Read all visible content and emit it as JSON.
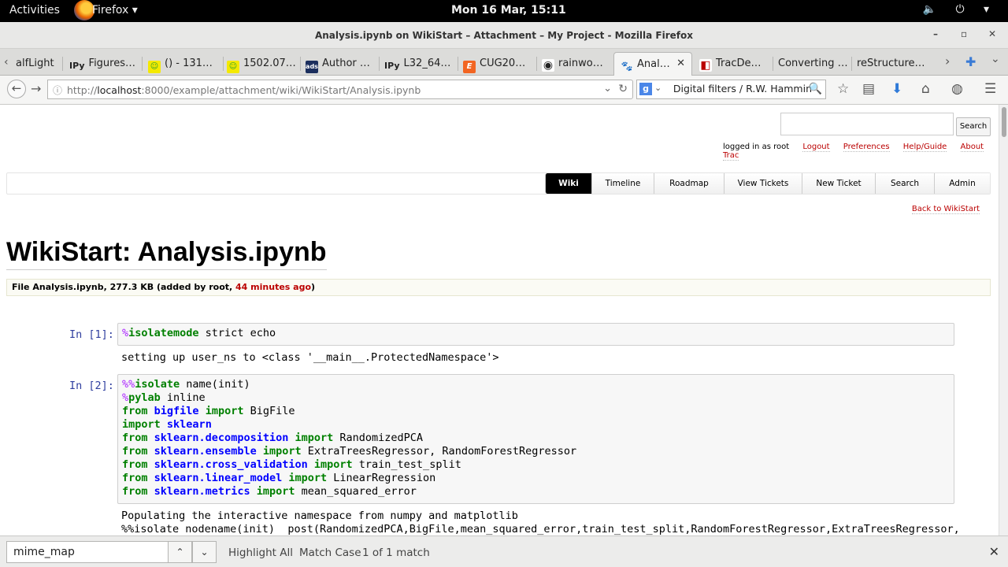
{
  "system": {
    "activities": "Activities",
    "app_name": "Firefox ▾",
    "clock": "Mon 16 Mar, 15:11",
    "tray": "🔈 ⏻ ▾"
  },
  "window": {
    "title": "Analysis.ipynb on WikiStart – Attachment – My Project - Mozilla Firefox",
    "minimize": "–",
    "maximize": "▫",
    "close": "✕"
  },
  "tabs": [
    {
      "label": "alfLight",
      "favicon_text": "",
      "favicon_color": ""
    },
    {
      "label": "Figures…",
      "favicon_text": "IPy",
      "favicon_color": ""
    },
    {
      "label": "() - 131…",
      "favicon_text": "☺",
      "favicon_color": "#2fa12f"
    },
    {
      "label": "1502.07…",
      "favicon_text": "☺",
      "favicon_color": "#2fa12f"
    },
    {
      "label": "Author …",
      "favicon_text": "ads",
      "favicon_color": "#1c2f5e"
    },
    {
      "label": "L32_64…",
      "favicon_text": "IPy",
      "favicon_color": ""
    },
    {
      "label": "CUG20…",
      "favicon_text": "E",
      "favicon_color": "#f26522"
    },
    {
      "label": "rainwo…",
      "favicon_text": "◉",
      "favicon_color": "#222"
    },
    {
      "label": "Anal…",
      "favicon_text": "🐾",
      "favicon_color": ""
    },
    {
      "label": "TracDe…",
      "favicon_text": "◧",
      "favicon_color": "#b00"
    },
    {
      "label": "Converting …",
      "favicon_text": "",
      "favicon_color": ""
    },
    {
      "label": "reStructure…",
      "favicon_text": "",
      "favicon_color": ""
    }
  ],
  "tab_controls": {
    "scroll_left": "‹",
    "scroll_right": "›",
    "new_tab": "✚",
    "list_all": "⌄",
    "close_active": "✕"
  },
  "navbar": {
    "url_prefix": "http://",
    "url_host": "localhost",
    "url_rest": ":8000/example/attachment/wiki/WikiStart/Analysis.ipynb",
    "search_value": "Digital filters / R.W. Hammin",
    "search_engine": "g"
  },
  "trac": {
    "search_button": "Search",
    "logged_in": "logged in as root",
    "metanav": [
      "Logout",
      "Preferences",
      "Help/Guide",
      "About Trac"
    ],
    "mainnav": [
      "Wiki",
      "Timeline",
      "Roadmap",
      "View Tickets",
      "New Ticket",
      "Search",
      "Admin"
    ],
    "back_link": "Back to WikiStart",
    "heading": "WikiStart: Analysis.ipynb",
    "file_info_pre": "File Analysis.ipynb, 277.3 KB (added by root, ",
    "file_info_ago": "44 minutes ago",
    "file_info_post": ")"
  },
  "notebook": {
    "prompt1": "In [1]:",
    "prompt2": "In [2]:",
    "cell1": {
      "magic": "%",
      "cmd": "isolatemode",
      "rest": " strict echo"
    },
    "out1": "setting up user_ns to <class '__main__.ProtectedNamespace'>",
    "cell2": {
      "l1_magic": "%%",
      "l1_cmd": "isolate",
      "l1_rest": " name(init)",
      "l2_magic": "%",
      "l2_cmd": "pylab",
      "l2_rest": " inline",
      "from": "from",
      "import": "import",
      "m_bigfile": "bigfile",
      "r_bigfile": " BigFile",
      "m_sklearn": "sklearn",
      "m_decomp": "sklearn.decomposition",
      "r_decomp": " RandomizedPCA",
      "m_ensemble": "sklearn.ensemble",
      "r_ensemble": " ExtraTreesRegressor, RandomForestRegressor",
      "m_cv": "sklearn.cross_validation",
      "r_cv": " train_test_split",
      "m_linear": "sklearn.linear_model",
      "r_linear": " LinearRegression",
      "m_metrics": "sklearn.metrics",
      "r_metrics": " mean_squared_error"
    },
    "out2_line1": "Populating the interactive namespace from numpy and matplotlib",
    "out2_line2": "%%isolate nodename(init)  post(RandomizedPCA,BigFile,mean_squared_error,train_test_split,RandomForestRegressor,ExtraTreesRegressor,"
  },
  "findbar": {
    "value": "mime_map",
    "prev": "⌃",
    "next": "⌄",
    "highlight_all": "Highlight All",
    "match_case": "Match Case",
    "result": "1 of 1 match",
    "close": "✕"
  }
}
